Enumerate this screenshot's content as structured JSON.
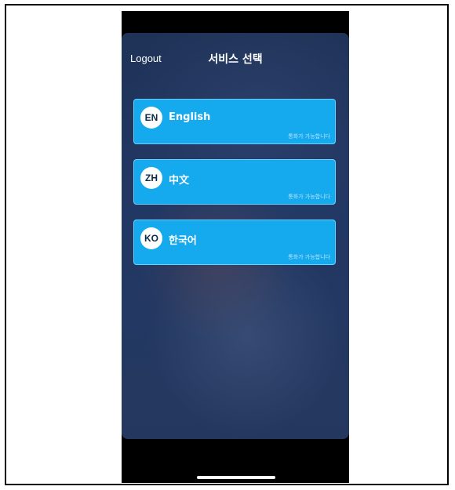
{
  "header": {
    "logout_label": "Logout",
    "title": "서비스 선택"
  },
  "services": [
    {
      "code": "EN",
      "name": "English",
      "status": "통화가 가능합니다"
    },
    {
      "code": "ZH",
      "name": "中文",
      "status": "통화가 가능합니다"
    },
    {
      "code": "KO",
      "name": "한국어",
      "status": "통화가 가능합니다"
    }
  ],
  "colors": {
    "card": "#15a9ee",
    "background": "#223864"
  }
}
